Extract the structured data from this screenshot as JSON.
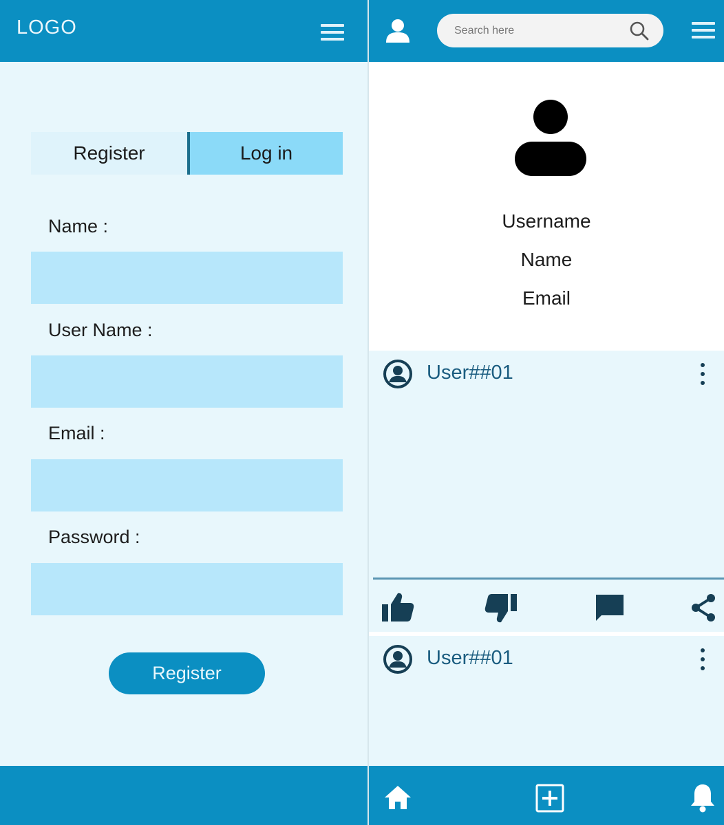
{
  "register_screen": {
    "logo": "LOGO",
    "tabs": {
      "register_label": "Register",
      "login_label": "Log in",
      "active": "Log in"
    },
    "fields": [
      {
        "label": "Name :",
        "value": ""
      },
      {
        "label": "User Name :",
        "value": ""
      },
      {
        "label": "Email :",
        "value": ""
      },
      {
        "label": "Password :",
        "value": ""
      }
    ],
    "submit_label": "Register"
  },
  "profile_screen": {
    "search": {
      "placeholder": "Search here"
    },
    "profile": {
      "username": "Username",
      "name": "Name",
      "email": "Email"
    },
    "posts": [
      {
        "user": "User##01"
      },
      {
        "user": "User##01"
      }
    ],
    "actions": [
      "like-icon",
      "dislike-icon",
      "comment-icon",
      "share-icon"
    ],
    "bottom_nav": [
      "home-icon",
      "add-post-icon",
      "notifications-icon"
    ]
  },
  "colors": {
    "primary": "#0b8fc2",
    "background": "#e8f7fc",
    "input_fill": "#b7e7fb",
    "active_tab": "#8bdaf8",
    "user_text": "#1b5d80"
  }
}
